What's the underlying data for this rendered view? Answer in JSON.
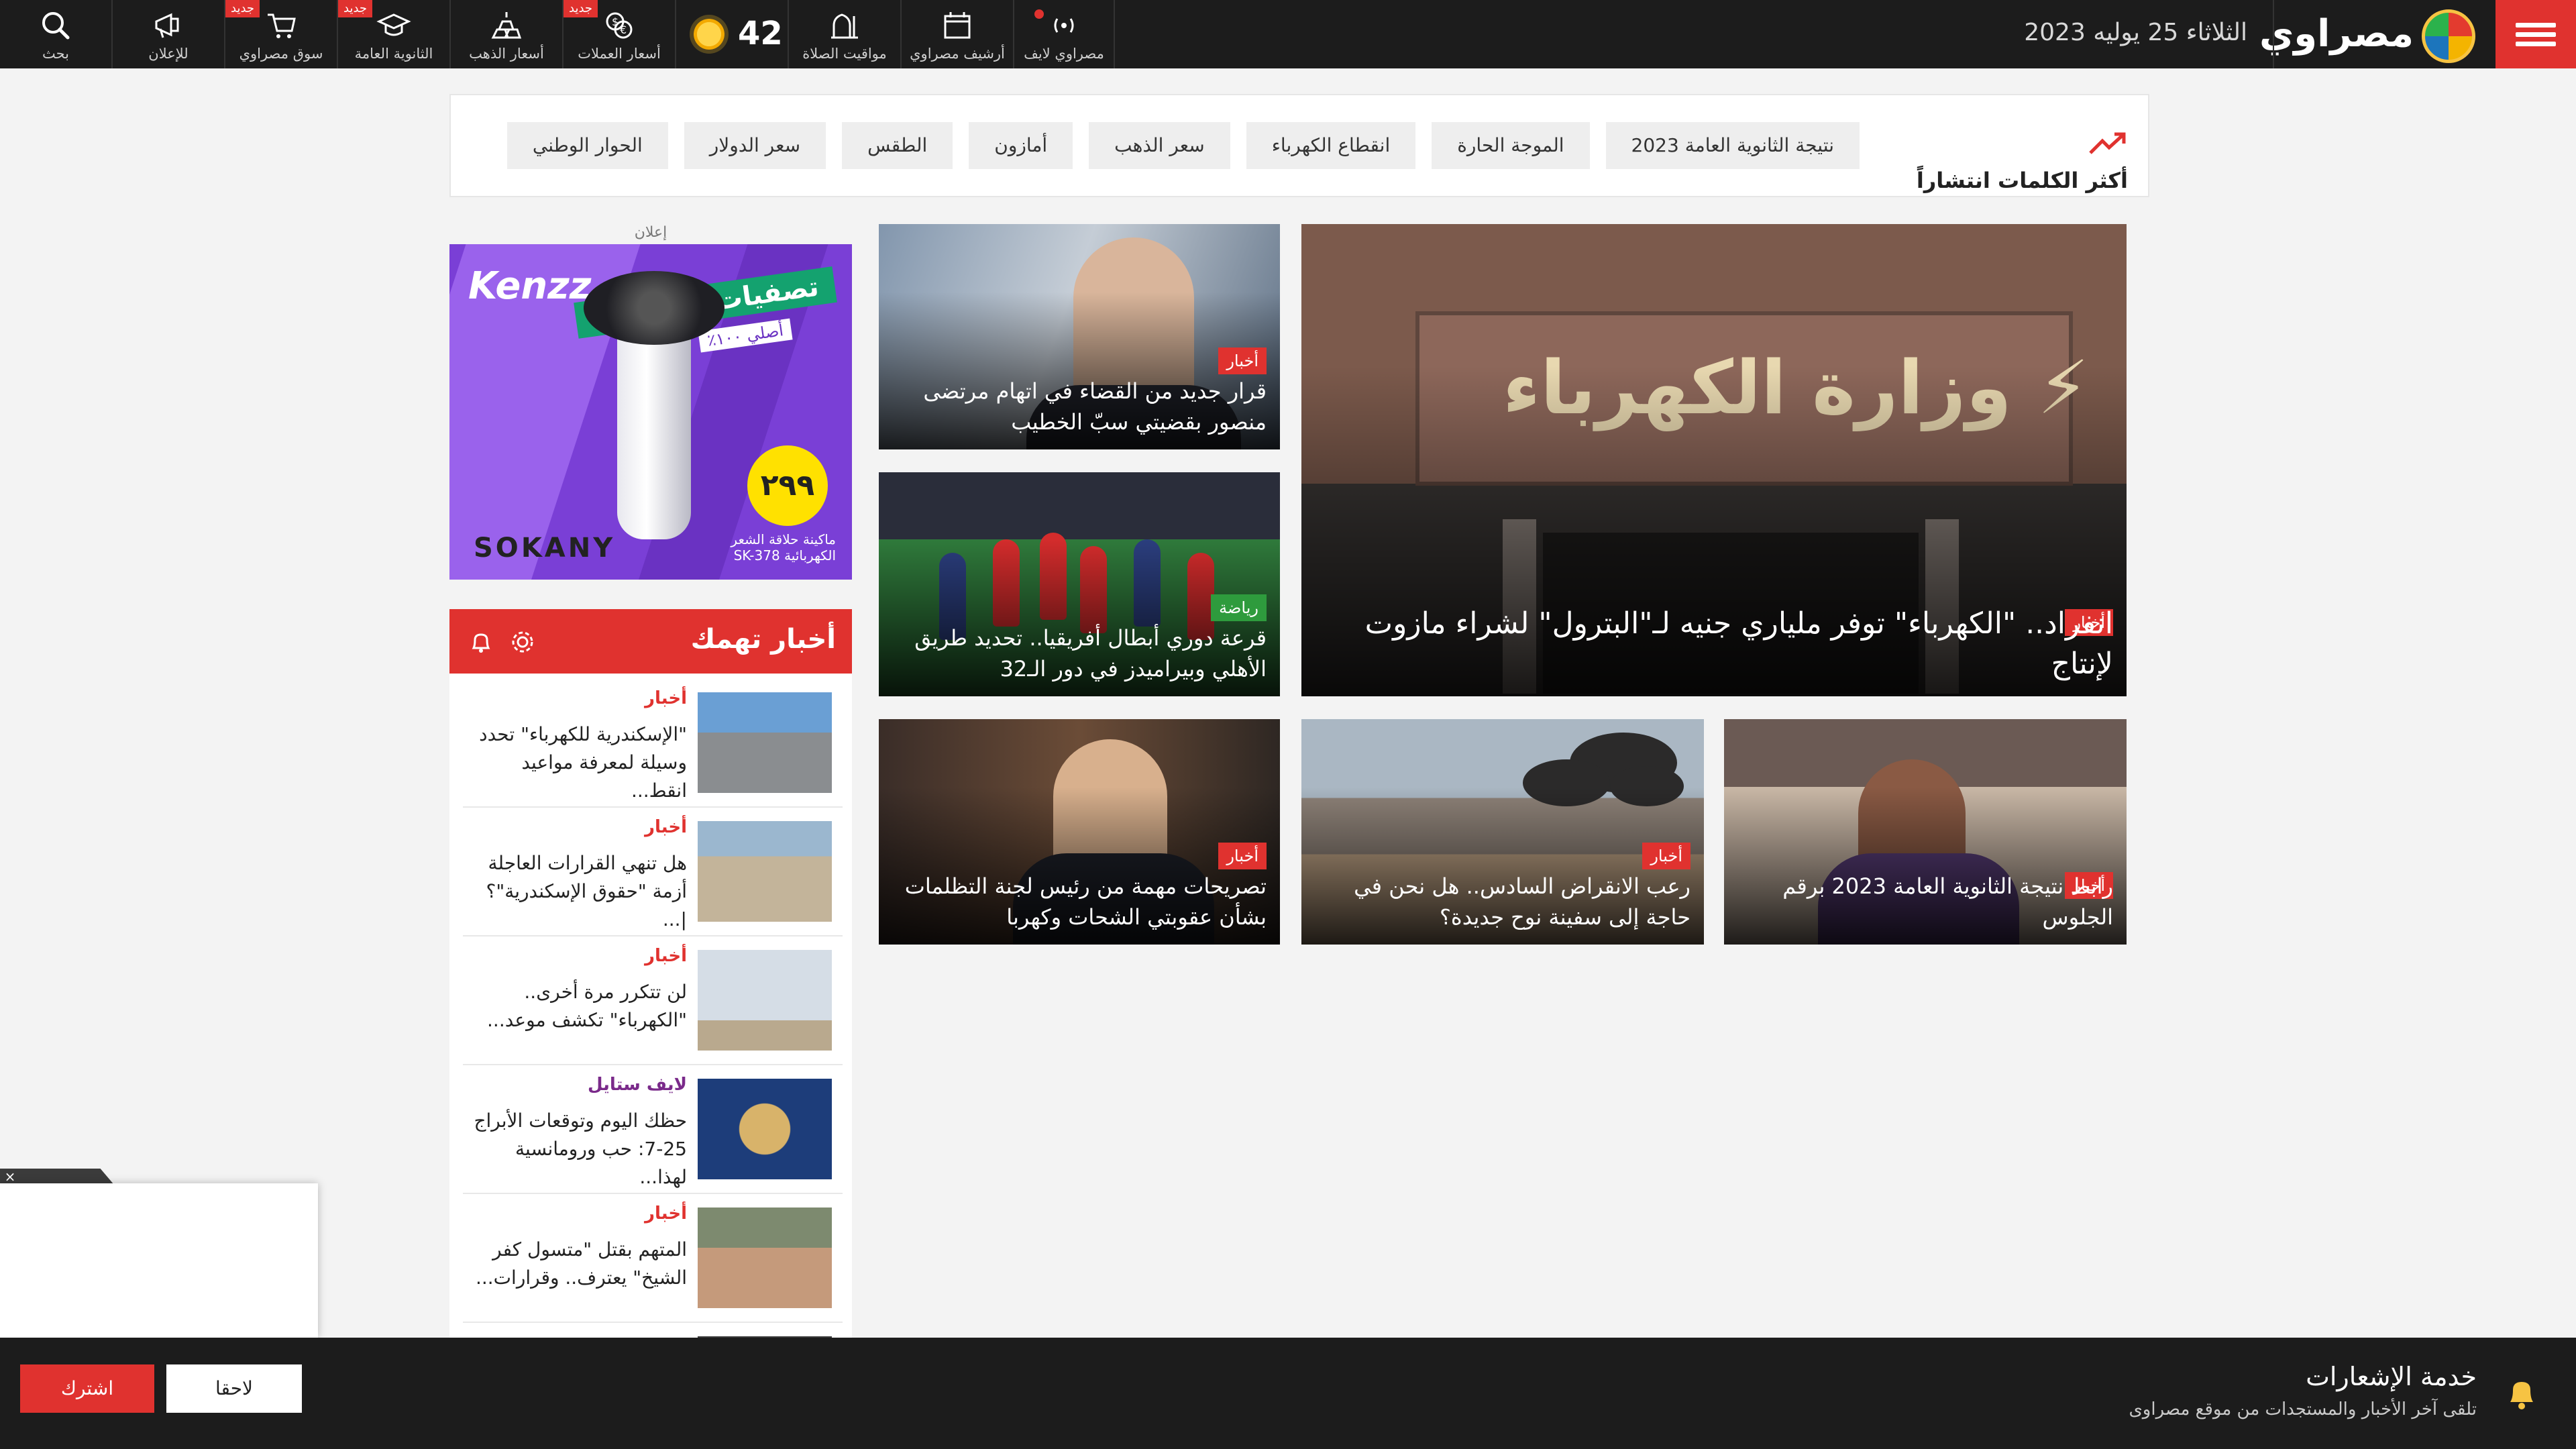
{
  "header": {
    "logo_text": "مصراوي",
    "date": "الثلاثاء 25 يوليه 2023",
    "nav": [
      {
        "label": "بحث",
        "icon": "search-icon"
      },
      {
        "label": "للإعلان",
        "icon": "megaphone-icon"
      },
      {
        "label": "سوق مصراوي",
        "icon": "cart-icon",
        "badge": "جديد"
      },
      {
        "label": "الثانوية العامة",
        "icon": "graduation-cap-icon",
        "badge": "جديد"
      },
      {
        "label": "أسعار الذهب",
        "icon": "gold-bars-icon"
      },
      {
        "label": "أسعار العملات",
        "icon": "currency-icon",
        "badge": "جديد"
      },
      {
        "label": "مواقيت الصلاة",
        "icon": "mosque-icon"
      },
      {
        "label": "أرشيف مصراوي",
        "icon": "calendar-icon"
      },
      {
        "label": "مصراوي لايف",
        "icon": "live-broadcast-icon"
      }
    ],
    "weather": {
      "temp": "42",
      "icon": "sun-icon"
    }
  },
  "trending": {
    "title": "أكثر الكلمات انتشاراً",
    "tags": [
      "نتيجة الثانوية العامة 2023",
      "الموجة الحارة",
      "انقطاع الكهرباء",
      "سعر الذهب",
      "أمازون",
      "الطقس",
      "سعر الدولار",
      "الحوار الوطني"
    ]
  },
  "main_news": [
    {
      "category": "أخبار",
      "title": "انفراد.. \"الكهرباء\" توفر ملياري جنيه لـ\"البترول\" لشراء مازوت لإنتاج",
      "image": "ministry-of-electricity-building"
    },
    {
      "category": "أخبار",
      "title": "قرار جديد من القضاء في اتهام مرتضى منصور بقضيتي سبّ الخطيب",
      "image": "man-portrait"
    },
    {
      "category": "رياضة",
      "title": "قرعة دوري أبطال أفريقيا.. تحديد طريق الأهلي وبيراميدز في دور الـ32",
      "image": "football-match"
    },
    {
      "category": "أخبار",
      "title": "رابط نتيجة الثانوية العامة 2023 برقم الجلوس",
      "image": "students-exam"
    },
    {
      "category": "أخبار",
      "title": "رعب الانقراض السادس.. هل نحن في حاجة إلى سفينة نوح جديدة؟",
      "image": "desert-skeleton"
    },
    {
      "category": "أخبار",
      "title": "تصريحات مهمة من رئيس لجنة التظلمات بشأن عقوبتي الشحات وكهربا",
      "image": "official-at-desk"
    }
  ],
  "ad": {
    "label": "إعلان",
    "brand": "Kenzz",
    "promo": "تصفيات الماركات",
    "promo_sub": "أصلي ١٠٠٪",
    "price": "٢٩٩",
    "product_brand": "SOKANY",
    "product_desc": "ماكينة حلاقة الشعر الكهربائية SK-378"
  },
  "side_panel": {
    "title": "أخبار تهمك",
    "items": [
      {
        "category": "أخبار",
        "title": "\"الإسكندرية للكهرباء\" تحدد وسيلة لمعرفة مواعيد انقط..."
      },
      {
        "category": "أخبار",
        "title": "هل تنهي القرارات العاجلة أزمة \"حقوق الإسكندرية\"؟ |..."
      },
      {
        "category": "أخبار",
        "title": "لن تتكرر مرة أخرى.. \"الكهرباء\" تكشف موعد..."
      },
      {
        "category": "لايف ستايل",
        "title": "حظك اليوم وتوقعات الأبراج 25-7: حب ورومانسية لهذا..."
      },
      {
        "category": "أخبار",
        "title": "المتهم بقتل \"متسول كفر الشيخ\" يعترف.. وقرارات..."
      }
    ]
  },
  "notification": {
    "title": "خدمة الإشعارات",
    "subtitle": "تلقى آخر الأخبار والمستجدات من موقع مصراوى",
    "later_label": "لاحقا",
    "subscribe_label": "اشترك"
  },
  "colors": {
    "accent": "#e0322f",
    "header_bg": "#1c1c1c",
    "sport": "#2e9b3d",
    "lifestyle": "#7a2a8a"
  }
}
